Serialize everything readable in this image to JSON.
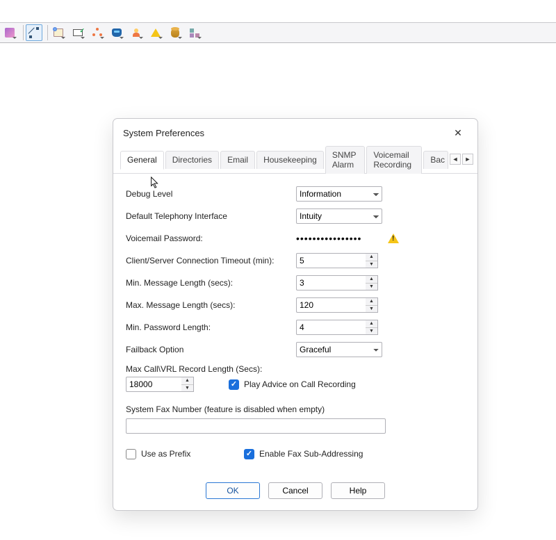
{
  "toolbar": {
    "items": [
      "tool-split",
      "tool-connector",
      "tool-server",
      "tool-monitor",
      "tool-nodes",
      "tool-phone",
      "tool-user",
      "tool-warning",
      "tool-database",
      "tool-boxes"
    ]
  },
  "dialog": {
    "title": "System Preferences",
    "tabs": [
      "General",
      "Directories",
      "Email",
      "Housekeeping",
      "SNMP Alarm",
      "Voicemail Recording",
      "Bac"
    ],
    "active_tab": 0,
    "fields": {
      "debug_level": {
        "label": "Debug Level",
        "value": "Information"
      },
      "telephony": {
        "label": "Default Telephony Interface",
        "value": "Intuity"
      },
      "vm_password": {
        "label": "Voicemail Password:",
        "value": "••••••••••••••••"
      },
      "timeout": {
        "label": "Client/Server Connection Timeout (min):",
        "value": "5"
      },
      "min_msg": {
        "label": "Min. Message Length (secs):",
        "value": "3"
      },
      "max_msg": {
        "label": "Max. Message Length (secs):",
        "value": "120"
      },
      "min_pw": {
        "label": "Min. Password Length:",
        "value": "4"
      },
      "failback": {
        "label": "Failback Option",
        "value": "Graceful"
      },
      "max_call": {
        "label": "Max Call\\VRL Record Length (Secs):",
        "value": "18000"
      },
      "play_advice": {
        "label": "Play Advice on Call Recording",
        "checked": true
      },
      "fax_number": {
        "label": "System Fax Number (feature is disabled when empty)",
        "value": ""
      },
      "use_prefix": {
        "label": "Use as Prefix",
        "checked": false
      },
      "enable_fax": {
        "label": "Enable Fax Sub-Addressing",
        "checked": true
      }
    },
    "buttons": {
      "ok": "OK",
      "cancel": "Cancel",
      "help": "Help"
    }
  }
}
